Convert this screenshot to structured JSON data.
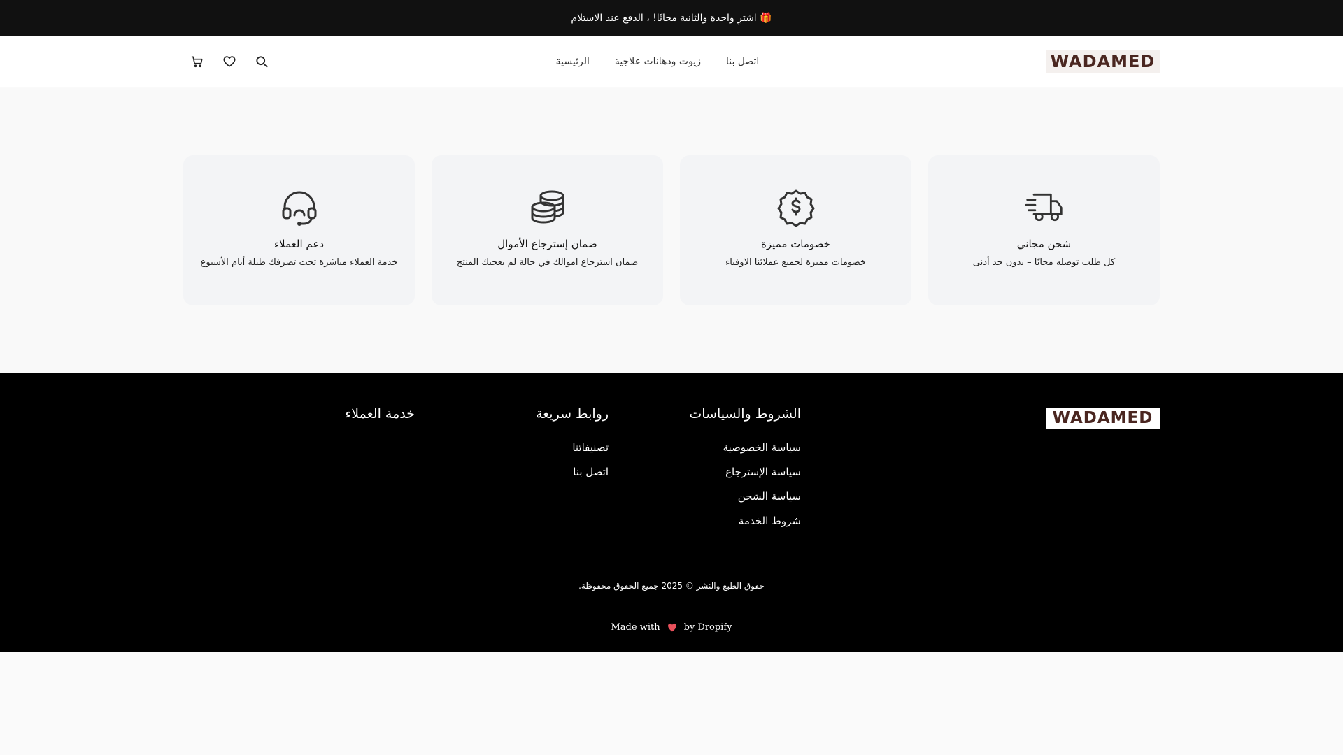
{
  "announcement": "🎁 اشترِ واحدة والثانية مجانًا! ، الدفع عند الاستلام",
  "brand": {
    "logo_text": "WADAMED",
    "logo_color": "#4a2620"
  },
  "nav": [
    {
      "label": "الرئيسية"
    },
    {
      "label": "زيوت ودهانات علاجية"
    },
    {
      "label": "اتصل بنا"
    }
  ],
  "header_icons": [
    "search-icon",
    "heart-icon",
    "cart-icon"
  ],
  "features": [
    {
      "icon": "truck-icon",
      "title": "شحن مجاني",
      "desc": "كل طلب توصله مجانًا – بدون حد أدنى"
    },
    {
      "icon": "discount-badge-icon",
      "title": "خصومات مميزة",
      "desc": "خصومات مميزة لجميع عملائنا الاوفياء"
    },
    {
      "icon": "coins-icon",
      "title": "ضمان إسترجاع الأموال",
      "desc": "ضمان استرجاع اموالك في حالة لم يعجبك المنتج"
    },
    {
      "icon": "headset-icon",
      "title": "دعم العملاء",
      "desc": "خدمة العملاء مباشرة تحت تصرفك طيلة أيام الأسبوع"
    }
  ],
  "footer": {
    "policies": {
      "title": "الشروط والسياسات",
      "links": [
        "سياسة الخصوصية",
        "سياسة الإسترجاع",
        "سياسة الشحن",
        "شروط الخدمة"
      ]
    },
    "quick_links": {
      "title": "روابط سريعة",
      "links": [
        "تصنيفاتنا",
        "اتصل بنا"
      ]
    },
    "customer_service": {
      "title": "خدمة العملاء"
    },
    "copyright": "حقوق الطبع والنشر © 2025 جميع الحقوق محفوظة.",
    "made_with": "Made with",
    "by": "by Dropify",
    "heart_color": "#e8505b"
  }
}
